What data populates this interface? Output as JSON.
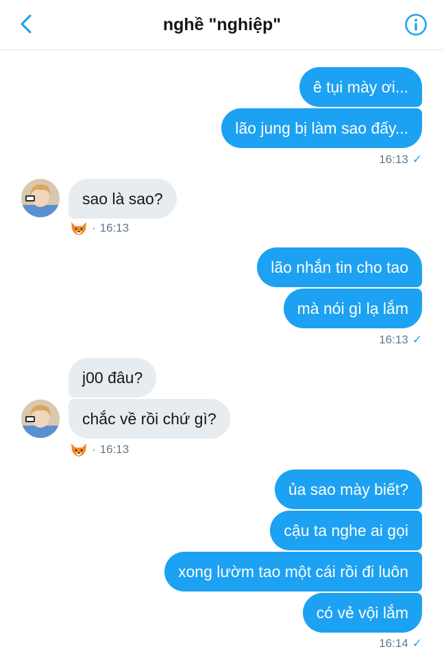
{
  "header": {
    "title": "nghề \"nghiệp\"",
    "back_icon": "chevron-left-icon",
    "info_icon": "info-icon"
  },
  "colors": {
    "accent": "#1da1f2",
    "incoming_bubble": "#e6ecf0",
    "meta_text": "#657786"
  },
  "messages": {
    "g1": {
      "m1": "ê tụi mày ơi...",
      "m2": "lão jung bị làm sao đấy...",
      "time": "16:13",
      "check": "✓"
    },
    "g2": {
      "m1": "sao là sao?",
      "dot": "·",
      "time": "16:13",
      "reaction_icon": "fox-icon"
    },
    "g3": {
      "m1": "lão nhắn tin cho tao",
      "m2": "mà nói gì lạ lắm",
      "time": "16:13",
      "check": "✓"
    },
    "g4": {
      "m1": "j00 đâu?",
      "m2": "chắc về rồi chứ gì?",
      "dot": "·",
      "time": "16:13",
      "reaction_icon": "fox-icon"
    },
    "g5": {
      "m1": "ủa sao mày biết?",
      "m2": "cậu ta nghe ai gọi",
      "m3": "xong lườm tao một cái rồi đi luôn",
      "m4": "có vẻ vội lắm",
      "time": "16:14",
      "check": "✓"
    }
  }
}
